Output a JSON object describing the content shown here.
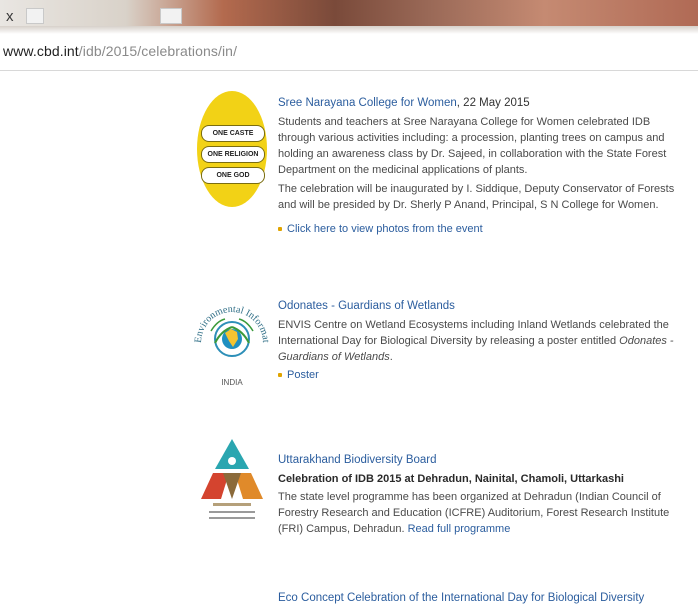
{
  "browser": {
    "tab_close": "x",
    "url_domain": "www.cbd.int",
    "url_path": "/idb/2015/celebrations/in/"
  },
  "entries": [
    {
      "title": "Sree Narayana College for Women",
      "date": ", 22 May 2015",
      "para1": "Students and teachers at Sree Narayana College for Women celebrated IDB through various activities including: a procession, planting trees on campus and holding an awareness class by Dr. Sajeed, in collaboration with the State Forest Department on the medicinal applications of plants.",
      "para2": "The celebration will be inaugurated by I. Siddique, Deputy Conservator of Forests and will be presided by Dr. Sherly P Anand, Principal, S N College for Women.",
      "link": "Click here to view photos from the event",
      "logo_text": [
        "ONE CASTE",
        "ONE RELIGION",
        "ONE GOD"
      ]
    },
    {
      "title": "Odonates - Guardians of Wetlands",
      "para_pre": "ENVIS Centre on Wetland Ecosystems including Inland Wetlands celebrated the International Day for Biological Diversity by releasing a poster entitled ",
      "para_em": "Odonates - Guardians of Wetlands",
      "para_post": ".",
      "link": "Poster",
      "logo_arc": "Environmental Information System",
      "logo_caption": "INDIA"
    },
    {
      "title": "Uttarakhand Biodiversity Board",
      "subtitle": "Celebration of IDB 2015 at Dehradun, Nainital, Chamoli, Uttarkashi",
      "para": "The state level programme has been organized at Dehradun (Indian Council of Forestry Research and Education (ICFRE) Auditorium, Forest Research Institute (FRI) Campus, Dehradun. ",
      "link": "Read full programme"
    },
    {
      "title": "Eco Concept Celebration of the International Day for Biological Diversity"
    }
  ],
  "colors": {
    "link": "#2b5d9e",
    "bullet": "#e0a400",
    "logo1": "#f2d216"
  }
}
